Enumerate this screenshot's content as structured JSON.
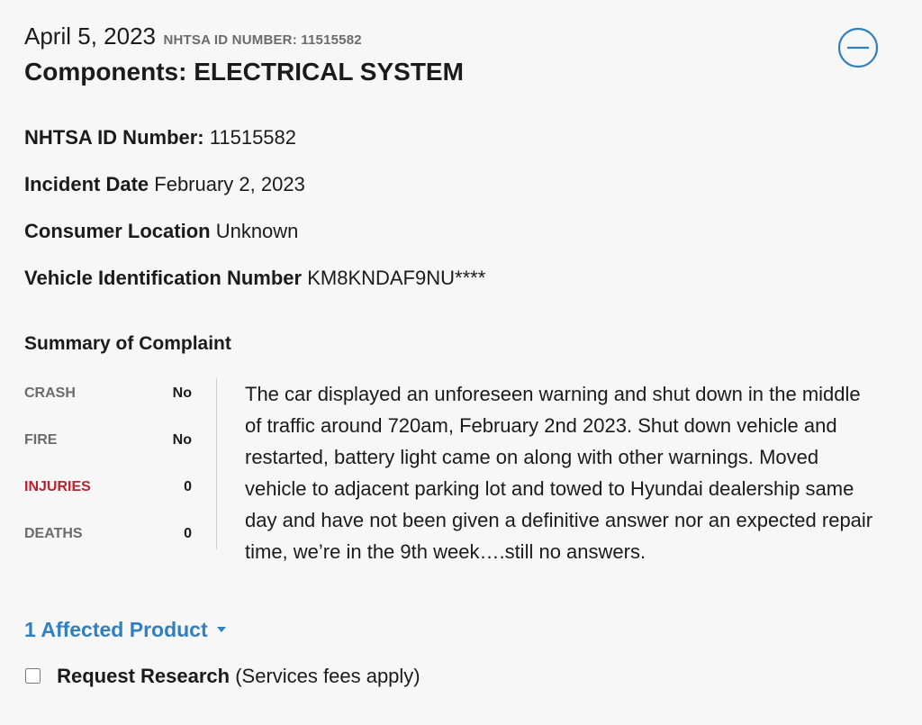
{
  "header": {
    "date": "April 5, 2023",
    "id_small": "NHTSA ID NUMBER: 11515582",
    "components": "Components: ELECTRICAL SYSTEM",
    "collapse_icon": "minus-circle-icon"
  },
  "details": {
    "id_label": "NHTSA ID Number:",
    "id_value": "11515582",
    "incident_label": "Incident Date",
    "incident_value": "February 2, 2023",
    "location_label": "Consumer Location",
    "location_value": "Unknown",
    "vin_label": "Vehicle Identification Number",
    "vin_value": "KM8KNDAF9NU****"
  },
  "summary": {
    "title": "Summary of Complaint",
    "stats": [
      {
        "key": "CRASH",
        "value": "No"
      },
      {
        "key": "FIRE",
        "value": "No"
      },
      {
        "key": "INJURIES",
        "value": "0"
      },
      {
        "key": "DEATHS",
        "value": "0"
      }
    ],
    "complaint_text": "The car displayed an unforeseen warning and shut down in the middle of traffic around 720am, February 2nd 2023. Shut down vehicle and restarted, battery light came on along with other warnings. Moved vehicle to adjacent parking lot and towed to Hyundai dealership same day and have not been given a definitive answer nor an expected repair time, we’re in the 9th week….still no answers."
  },
  "affected": {
    "label": "1 Affected Product"
  },
  "research": {
    "label": "Request Research",
    "note": " (Services fees apply)"
  },
  "colors": {
    "accent": "#2f7fc1",
    "injuries": "#b8232f",
    "muted": "#6b6b6b"
  }
}
